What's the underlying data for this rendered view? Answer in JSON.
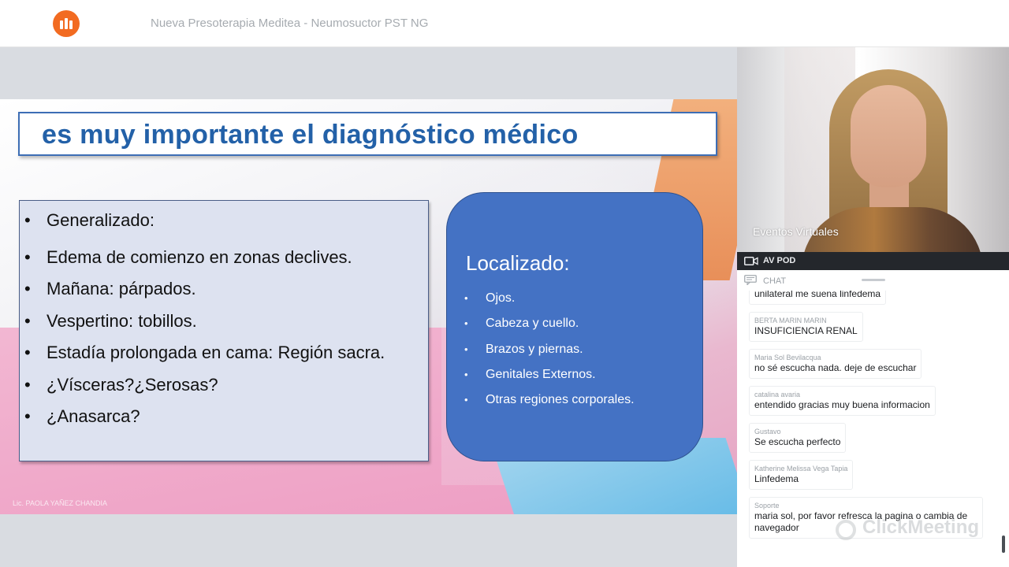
{
  "app": {
    "window_title": "Nueva Presoterapia Meditea - Neumosuctor PST NG",
    "brand_color": "#f26b21"
  },
  "slide": {
    "title": "es muy importante el diagnóstico médico",
    "left_items": [
      "Generalizado:",
      "Edema de comienzo en zonas declives.",
      "Mañana: párpados.",
      "Vespertino: tobillos.",
      "Estadía prolongada en cama: Región sacra.",
      "¿Vísceras?¿Serosas?",
      "¿Anasarca?"
    ],
    "right_title": "Localizado:",
    "right_items": [
      "Ojos.",
      "Cabeza y cuello.",
      "Brazos y piernas.",
      "Genitales Externos.",
      "Otras regiones corporales."
    ],
    "footer": "Lic. PAOLA YAÑEZ CHANDIA",
    "bullet": "•",
    "colors": {
      "title": "#2361a8",
      "right_box": "#4472c4"
    }
  },
  "video": {
    "label": "Eventos Virtuales"
  },
  "avpod": {
    "label": "AV POD",
    "icon": "video-camera-icon"
  },
  "chat": {
    "label": "CHAT",
    "icon": "chat-icon",
    "messages": [
      {
        "author": "",
        "text": "unilateral me suena linfedema"
      },
      {
        "author": "BERTA MARIN MARIN",
        "text": "INSUFICIENCIA RENAL"
      },
      {
        "author": "Maria Sol Bevilacqua",
        "text": "no sé escucha nada. deje de escuchar"
      },
      {
        "author": "catalina avaria",
        "text": "entendido gracias muy buena informacion"
      },
      {
        "author": "Gustavo",
        "text": "Se escucha perfecto"
      },
      {
        "author": "Katherine Melissa Vega Tapia",
        "text": "Linfedema"
      },
      {
        "author": "Soporte",
        "text": "maria sol, por favor refresca la pagina o cambia de navegador"
      }
    ]
  },
  "watermark": "ClickMeeting"
}
